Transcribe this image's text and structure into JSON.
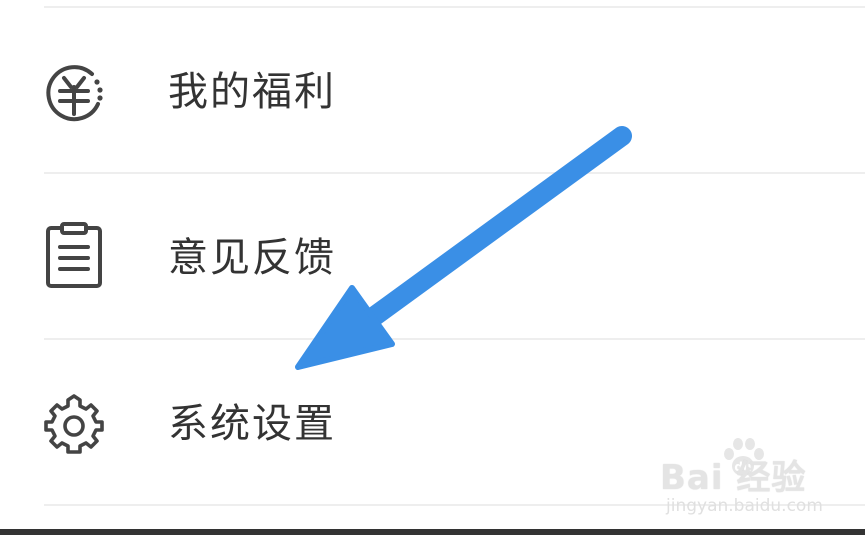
{
  "menu": {
    "items": [
      {
        "label": "我的福利",
        "icon": "yuan-coin-icon"
      },
      {
        "label": "意见反馈",
        "icon": "clipboard-icon"
      },
      {
        "label": "系统设置",
        "icon": "gear-icon"
      }
    ]
  },
  "watermark": {
    "logo_text": "Bai  经验",
    "site": "jingyan.baidu.com"
  },
  "colors": {
    "arrow": "#3a8fe6",
    "divider": "#eeeeee",
    "text": "#333333",
    "icon": "#444444"
  }
}
